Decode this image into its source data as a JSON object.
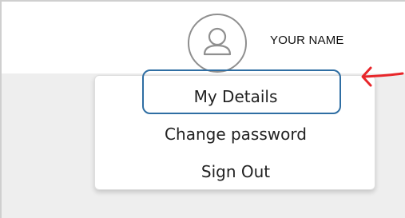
{
  "header": {
    "user_name": "YOUR NAME",
    "avatar_icon": "user-avatar-icon"
  },
  "menu": {
    "items": [
      {
        "label": "My Details",
        "highlighted": true
      },
      {
        "label": "Change password",
        "highlighted": false
      },
      {
        "label": "Sign Out",
        "highlighted": false
      }
    ]
  },
  "annotation": {
    "arrow_icon": "red-arrow-icon",
    "highlight_color": "#2f6ea3",
    "arrow_color": "#e8262a"
  },
  "colors": {
    "header_bg": "#ffffff",
    "content_bg": "#eeeeee",
    "menu_bg": "#ffffff"
  }
}
